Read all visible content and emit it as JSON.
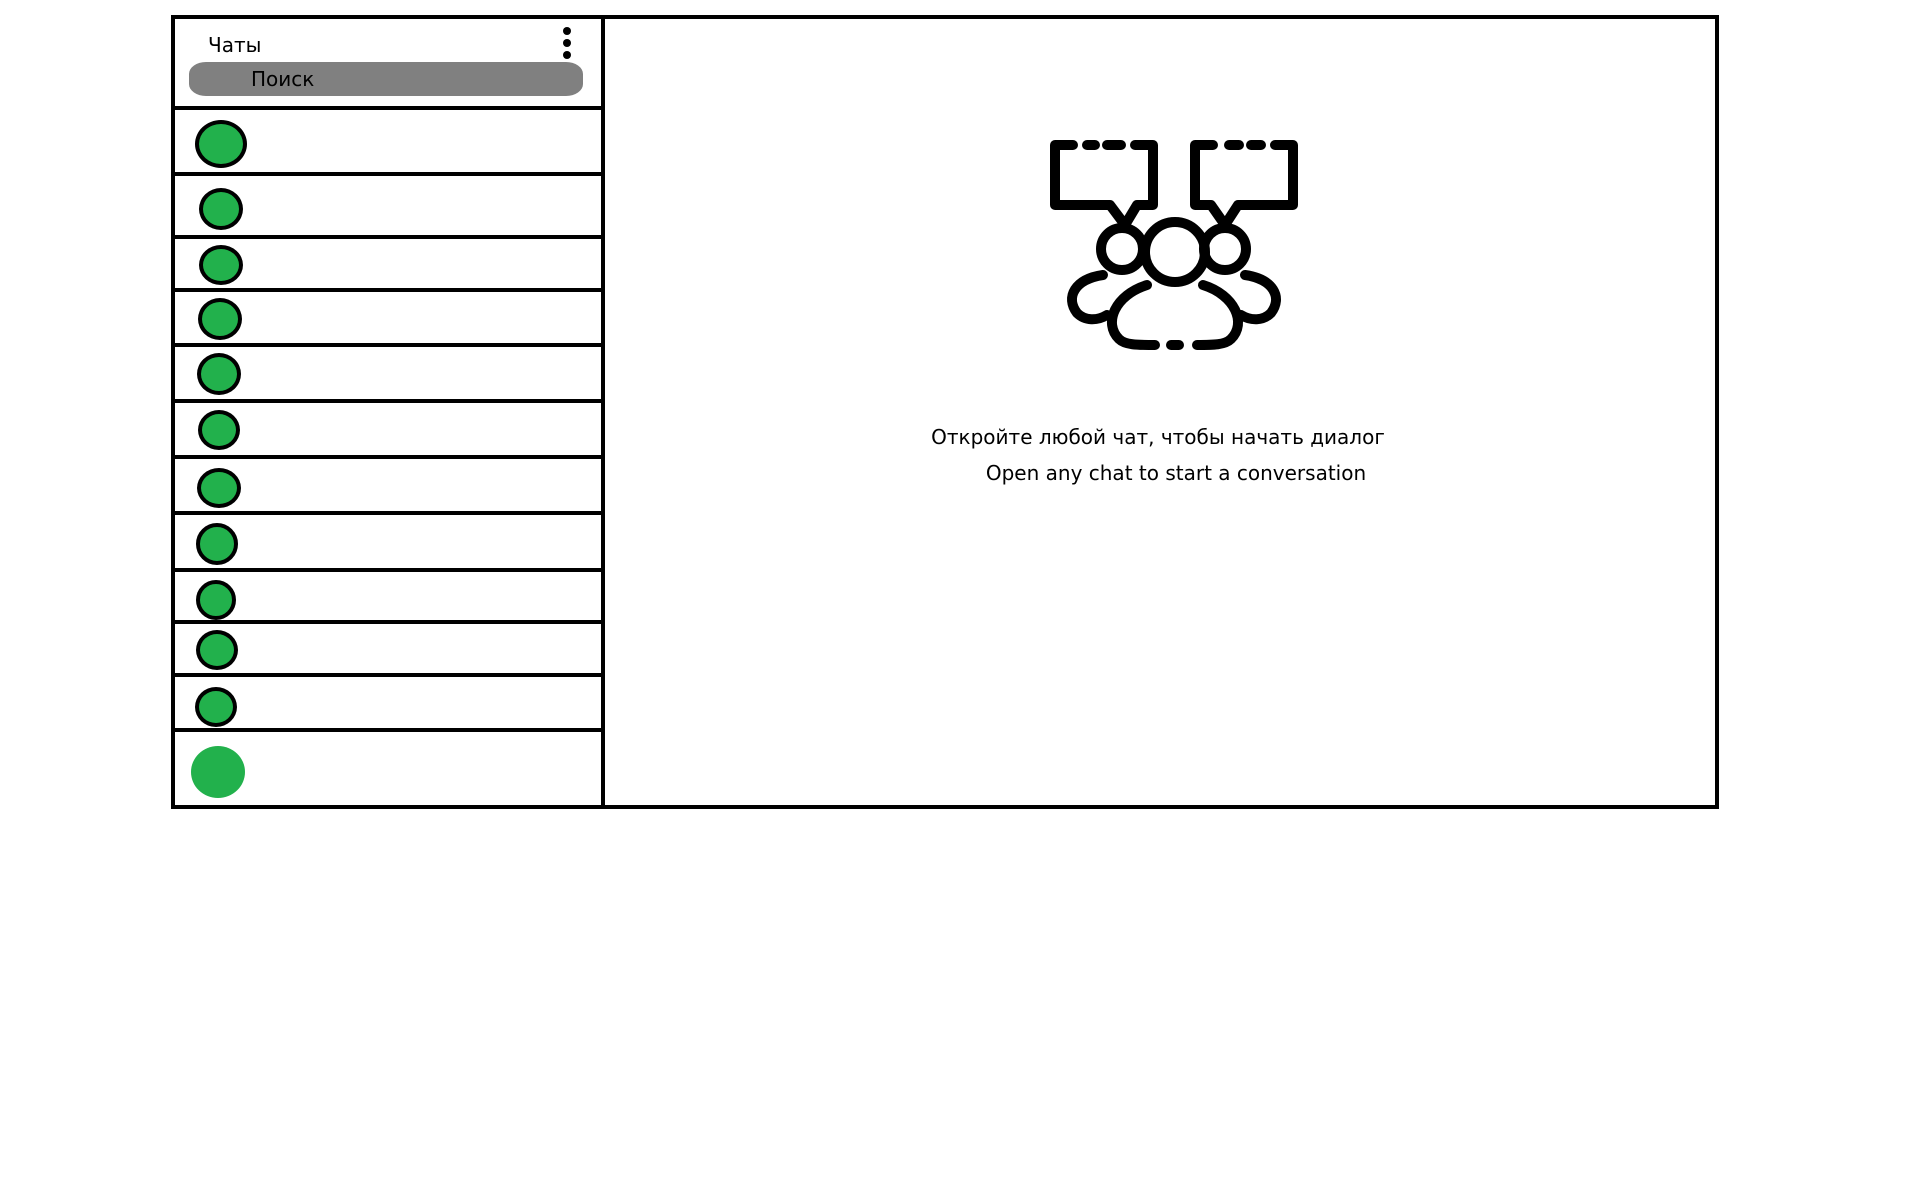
{
  "sidebar": {
    "title": "Чаты",
    "menu_icon": "more-vertical-icon",
    "search": {
      "placeholder": "Поиск"
    },
    "chats": [
      {
        "avatar_color": "#22b14c"
      },
      {
        "avatar_color": "#22b14c"
      },
      {
        "avatar_color": "#22b14c"
      },
      {
        "avatar_color": "#22b14c"
      },
      {
        "avatar_color": "#22b14c"
      },
      {
        "avatar_color": "#22b14c"
      },
      {
        "avatar_color": "#22b14c"
      },
      {
        "avatar_color": "#22b14c"
      },
      {
        "avatar_color": "#22b14c"
      },
      {
        "avatar_color": "#22b14c"
      },
      {
        "avatar_color": "#22b14c"
      },
      {
        "avatar_color": "#22b14c"
      }
    ]
  },
  "main": {
    "illustration_icon": "group-chat-icon",
    "empty_message_ru": "Откройте любой чат, чтобы начать диалог",
    "empty_message_en": "Open any chat to start a conversation"
  },
  "colors": {
    "avatar": "#22b14c",
    "search_background": "#808080",
    "border": "#000000"
  }
}
